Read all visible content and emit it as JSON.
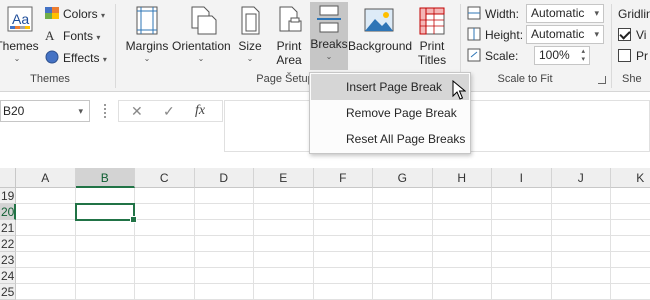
{
  "ribbon": {
    "themes_group": {
      "themes_label": "Themes",
      "colors_label": "Colors",
      "fonts_label": "Fonts",
      "effects_label": "Effects",
      "group_label": "Themes"
    },
    "page_setup_group": {
      "margins_label": "Margins",
      "orientation_label": "Orientation",
      "size_label": "Size",
      "print_area_label_1": "Print",
      "print_area_label_2": "Area",
      "breaks_label": "Breaks",
      "background_label": "Background",
      "print_titles_label_1": "Print",
      "print_titles_label_2": "Titles",
      "group_label": "Page Setup"
    },
    "scale_group": {
      "width_label": "Width:",
      "width_value": "Automatic",
      "height_label": "Height:",
      "height_value": "Automatic",
      "scale_label": "Scale:",
      "scale_value": "100%",
      "group_label": "Scale to Fit"
    },
    "sheet_options_group": {
      "gridlines_label": "Gridlin",
      "view_label": "Vi",
      "view_checked": true,
      "print_label": "Pr",
      "print_checked": false,
      "group_label": "She"
    }
  },
  "breaks_menu": {
    "items": [
      {
        "label": "Insert Page Break",
        "highlighted": true
      },
      {
        "label": "Remove Page Break",
        "highlighted": false
      },
      {
        "label": "Reset All Page Breaks",
        "highlighted": false
      }
    ]
  },
  "formula_bar": {
    "name_box_value": "B20",
    "fx_label": "fx",
    "formula_value": ""
  },
  "grid": {
    "columns": [
      "A",
      "B",
      "C",
      "D",
      "E",
      "F",
      "G",
      "H",
      "I",
      "J",
      "K"
    ],
    "selected_column": "B",
    "rows": [
      "19",
      "20",
      "21",
      "22",
      "23",
      "24",
      "25"
    ],
    "selected_row": "20",
    "active_cell": "B20"
  },
  "colors": {
    "accent_green": "#217346",
    "ribbon_bg": "#f3f3f3",
    "menu_highlight": "#d6d6d6"
  }
}
